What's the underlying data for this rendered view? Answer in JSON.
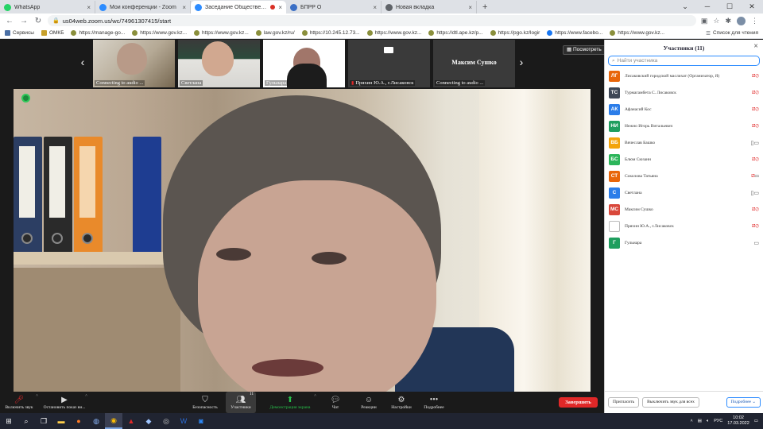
{
  "browser": {
    "tabs": [
      {
        "label": "WhatsApp",
        "color": "#25d366"
      },
      {
        "label": "Мои конференции - Zoom",
        "color": "#2d8cff"
      },
      {
        "label": "Заседание Общественного",
        "color": "#2d8cff",
        "active": true
      },
      {
        "label": "БПРР О",
        "color": "#3b6fc5"
      },
      {
        "label": "Новая вкладка",
        "color": "#5f6368"
      }
    ],
    "new_tab": "+",
    "url": "us04web.zoom.us/wc/74961307415/start",
    "bookmarks": [
      "Сервисы",
      "ОМКБ",
      "https://manage-go...",
      "https://www.gov.kz...",
      "https://www.gov.kz...",
      "law.gov.kz/ru/",
      "https://10.245.12.73...",
      "https://www.gov.kz...",
      "https://dtl.ape.kz/p...",
      "https://pgo.kz/logir",
      "https://www.facebo...",
      "https://www.gov.kz..."
    ],
    "reading_list": "Список для чтения"
  },
  "gallery": {
    "tiles": [
      {
        "name": "Connecting to audio ..."
      },
      {
        "name": "Светлана"
      },
      {
        "name": "Гульнара"
      },
      {
        "name": "Пряхин Ю.А., г.Лисаковск"
      },
      {
        "name": "Connecting to audio ...",
        "display_name": "Максим Сушко"
      }
    ],
    "view_button": "Посмотреть"
  },
  "toolbar": {
    "mute": "Включить звук",
    "video": "Остановить показ ви...",
    "security": "Безопасность",
    "participants": "Участники",
    "participants_count": "11",
    "share": "Демонстрация экрана",
    "chat": "Чат",
    "reactions": "Реакции",
    "settings": "Настройки",
    "more": "Подробнее",
    "end": "Завершить"
  },
  "panel": {
    "title": "Участники (11)",
    "search_placeholder": "Найти участника",
    "participants": [
      {
        "initials": "ЛГ",
        "name": "Лисаковский городской маслихат (Организатор, Я)",
        "color": "#e8660b",
        "audio": "muted",
        "video": "off"
      },
      {
        "initials": "ТС",
        "name": "Турмагамбета С. Лисаковск",
        "color": "#3e4756",
        "audio": "muted",
        "video": "off"
      },
      {
        "initials": "АК",
        "name": "Афанасий Кос",
        "color": "#2b7de9",
        "audio": "muted",
        "video": "off"
      },
      {
        "initials": "НИ",
        "name": "Нежно Игорь Витальевич",
        "color": "#1f9e5e",
        "audio": "muted",
        "video": "off"
      },
      {
        "initials": "ВБ",
        "name": "Вячеслав Башко",
        "color": "#f3a40b",
        "audio": "on",
        "video": "on"
      },
      {
        "initials": "БС",
        "name": "Блюм Сюзанн",
        "color": "#2cb55a",
        "audio": "muted",
        "video": "off"
      },
      {
        "initials": "СТ",
        "name": "Соколова Татьяна",
        "color": "#e8660b",
        "audio": "muted",
        "video": "on"
      },
      {
        "initials": "С",
        "name": "Светлана",
        "color": "#2b7de9",
        "audio": "on",
        "video": "on"
      },
      {
        "initials": "МС",
        "name": "Максим Сушко",
        "color": "#d9483b",
        "audio": "muted",
        "video": "off"
      },
      {
        "initials": "",
        "name": "Пряхин Ю.А., г.Лисаковск",
        "color": "#ffffff",
        "audio": "muted",
        "video": "off"
      },
      {
        "initials": "Г",
        "name": "Гульнара",
        "color": "#1f9e5e",
        "audio": "",
        "video": "on"
      }
    ],
    "invite": "Пригласить",
    "mute_all": "Выключить звук для всех",
    "more": "Подробнее"
  },
  "taskbar": {
    "lang": "РУС",
    "time": "10:02",
    "date": "17.03.2022"
  }
}
